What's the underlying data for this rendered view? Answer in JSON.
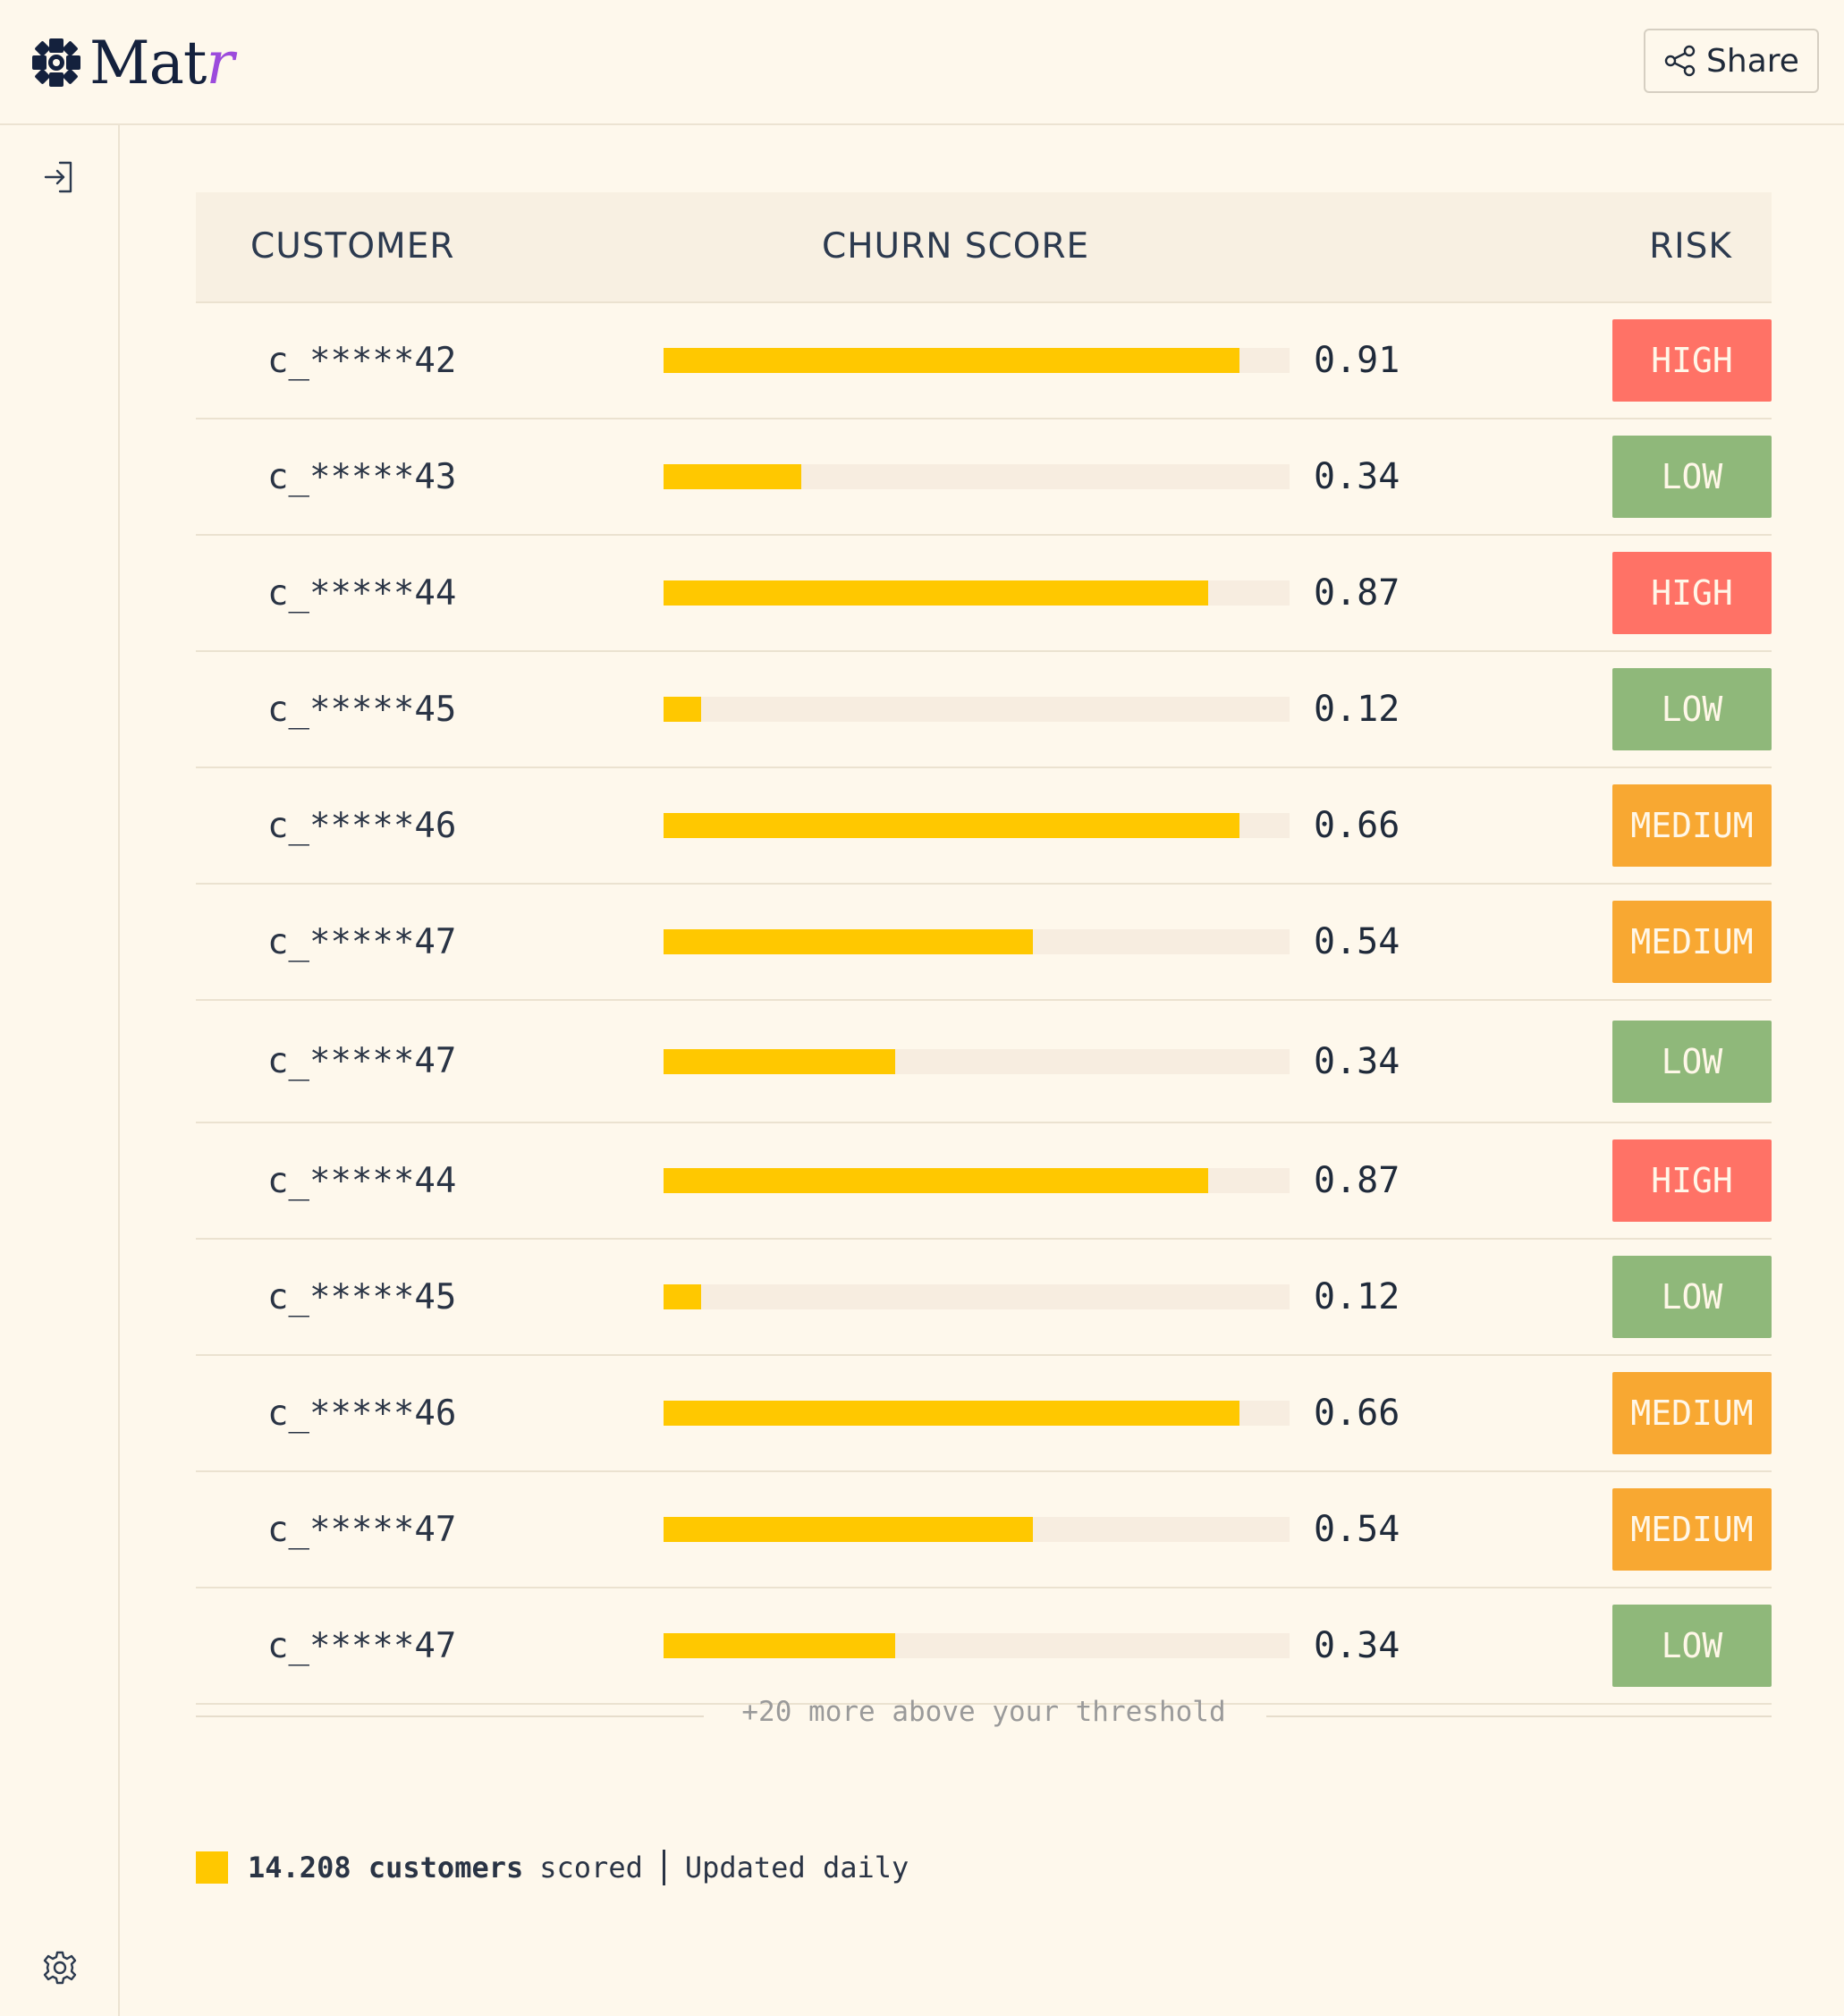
{
  "app": {
    "logo_prefix": "Mat",
    "logo_accent": "r",
    "share_label": "Share"
  },
  "table": {
    "headers": {
      "customer": "CUSTOMER",
      "score": "CHURN SCORE",
      "risk": "RISK"
    },
    "rows": [
      {
        "customer": "c_*****42",
        "score": "0.91",
        "fill_fraction": 0.92,
        "risk": "HIGH"
      },
      {
        "customer": "c_*****43",
        "score": "0.34",
        "fill_fraction": 0.22,
        "risk": "LOW"
      },
      {
        "customer": "c_*****44",
        "score": "0.87",
        "fill_fraction": 0.87,
        "risk": "HIGH"
      },
      {
        "customer": "c_*****45",
        "score": "0.12",
        "fill_fraction": 0.06,
        "risk": "LOW"
      },
      {
        "customer": "c_*****46",
        "score": "0.66",
        "fill_fraction": 0.92,
        "risk": "MEDIUM"
      },
      {
        "customer": "c_*****47",
        "score": "0.54",
        "fill_fraction": 0.59,
        "risk": "MEDIUM"
      },
      {
        "customer": "c_*****47",
        "score": "0.34",
        "fill_fraction": 0.37,
        "risk": "LOW"
      },
      {
        "customer": "c_*****44",
        "score": "0.87",
        "fill_fraction": 0.87,
        "risk": "HIGH"
      },
      {
        "customer": "c_*****45",
        "score": "0.12",
        "fill_fraction": 0.06,
        "risk": "LOW"
      },
      {
        "customer": "c_*****46",
        "score": "0.66",
        "fill_fraction": 0.92,
        "risk": "MEDIUM"
      },
      {
        "customer": "c_*****47",
        "score": "0.54",
        "fill_fraction": 0.59,
        "risk": "MEDIUM"
      },
      {
        "customer": "c_*****47",
        "score": "0.34",
        "fill_fraction": 0.37,
        "risk": "LOW"
      }
    ],
    "more_text": "+20 more above your threshold"
  },
  "risk_colors": {
    "HIGH": "#ff7266",
    "LOW": "#8fb87a",
    "MEDIUM": "#f8a832"
  },
  "bar_color": "#ffc800",
  "footer": {
    "count": "14.208 customers",
    "scored": "scored",
    "updated": "Updated daily"
  },
  "icons": {
    "logo": "flower-logo-icon",
    "share": "share-icon",
    "sidebar_top": "sign-in-icon",
    "sidebar_bottom": "gear-icon"
  }
}
